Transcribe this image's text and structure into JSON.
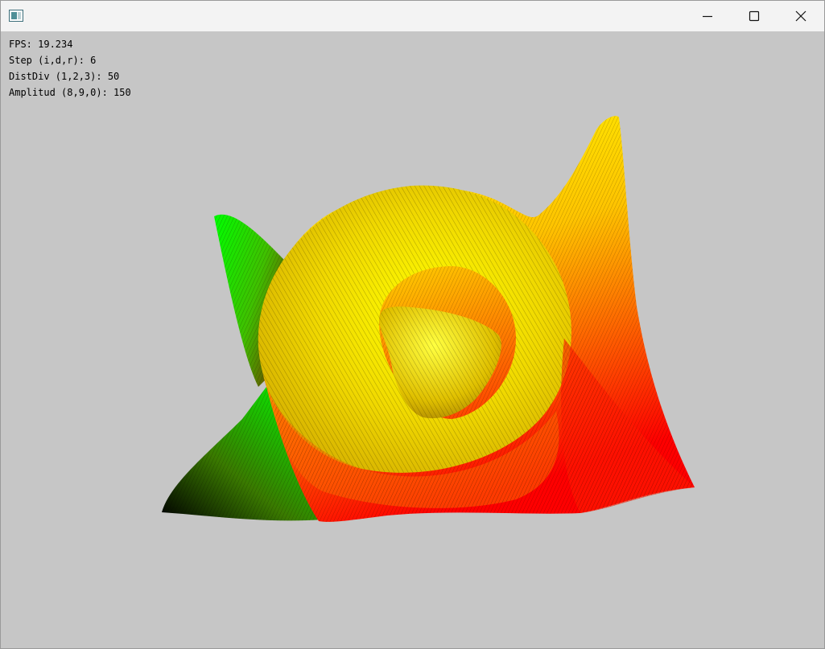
{
  "window": {
    "app_icon": "window-app-icon",
    "controls": {
      "minimize_icon": "minimize-icon",
      "maximize_icon": "maximize-icon",
      "close_icon": "close-icon"
    }
  },
  "hud": {
    "fps": "FPS: 19.234",
    "step": "Step (i,d,r): 6",
    "distdiv": "DistDiv (1,2,3): 50",
    "amplitud": "Amplitud (8,9,0): 150"
  },
  "scene": {
    "background_color": "#c6c6c6",
    "palette": {
      "green": "#00ff00",
      "yellow": "#ffff00",
      "red": "#ff0000",
      "dark": "#000000"
    }
  }
}
